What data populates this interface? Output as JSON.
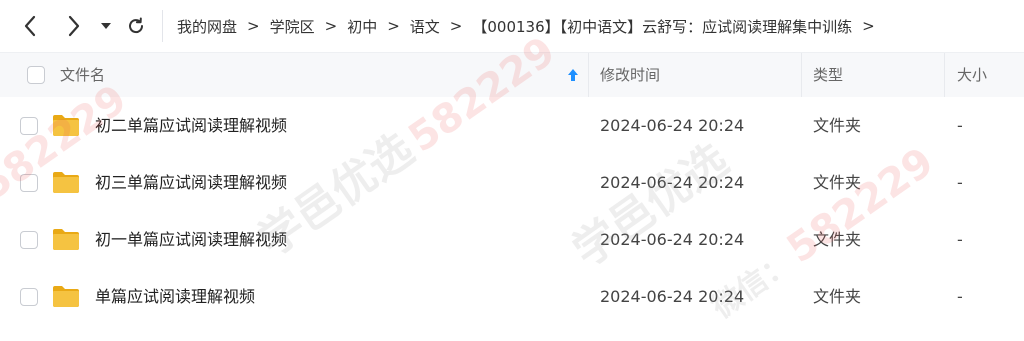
{
  "nav": {
    "breadcrumb": [
      "我的网盘",
      "学院区",
      "初中",
      "语文",
      "【000136】【初中语文】云舒写：应试阅读理解集中训练"
    ],
    "separator": ">",
    "back_icon": "chevron-left-icon",
    "forward_icon": "chevron-right-icon",
    "dropdown_icon": "caret-down-icon",
    "refresh_icon": "refresh-icon"
  },
  "table": {
    "columns": {
      "name": "文件名",
      "modified": "修改时间",
      "type": "类型",
      "size": "大小"
    },
    "sort": {
      "column": "name",
      "direction": "ascending"
    },
    "rows": [
      {
        "name": "初二单篇应试阅读理解视频",
        "modified": "2024-06-24 20:24",
        "type": "文件夹",
        "size": "-"
      },
      {
        "name": "初三单篇应试阅读理解视频",
        "modified": "2024-06-24 20:24",
        "type": "文件夹",
        "size": "-"
      },
      {
        "name": "初一单篇应试阅读理解视频",
        "modified": "2024-06-24 20:24",
        "type": "文件夹",
        "size": "-"
      },
      {
        "name": "单篇应试阅读理解视频",
        "modified": "2024-06-24 20:24",
        "type": "文件夹",
        "size": "-"
      }
    ]
  },
  "watermark": {
    "text": "学邑优选",
    "number": "582229",
    "wechat": "微信："
  },
  "colors": {
    "folder": "#f5c341",
    "folder_dark": "#e9a915",
    "accent": "#1e90ff",
    "header_bg": "#f7f8fa"
  }
}
